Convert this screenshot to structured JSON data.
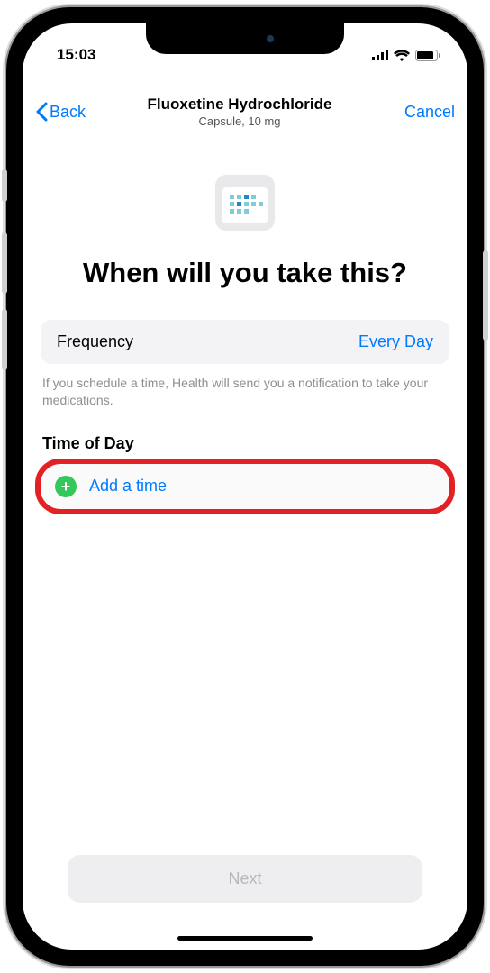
{
  "status": {
    "time": "15:03"
  },
  "nav": {
    "back_label": "Back",
    "title": "Fluoxetine Hydrochloride",
    "subtitle": "Capsule, 10 mg",
    "cancel_label": "Cancel"
  },
  "heading": "When will you take this?",
  "frequency": {
    "label": "Frequency",
    "value": "Every Day"
  },
  "hint": "If you schedule a time, Health will send you a notification to take your medications.",
  "time_section": {
    "title": "Time of Day",
    "add_label": "Add a time"
  },
  "next_label": "Next"
}
